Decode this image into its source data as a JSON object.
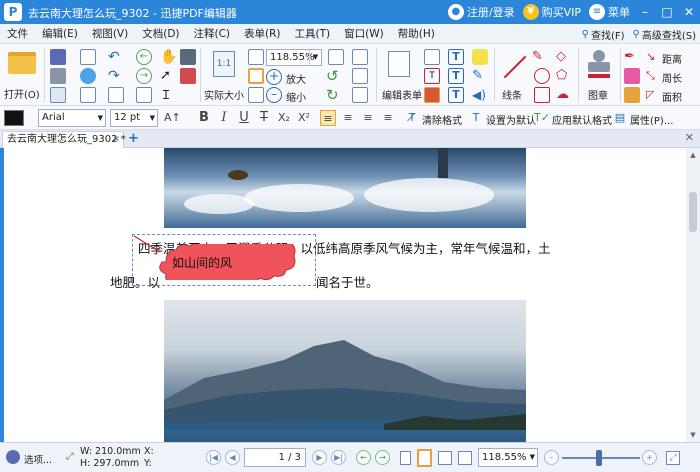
{
  "window": {
    "title": "去云南大理怎么玩_9302 - 迅捷PDF编辑器",
    "app_logo": "P",
    "login": "注册/登录",
    "vip": "购买VIP",
    "menu": "菜单"
  },
  "menubar": {
    "items": [
      "文件",
      "编辑(E)",
      "视图(V)",
      "文档(D)",
      "注释(C)",
      "表单(R)",
      "工具(T)",
      "窗口(W)",
      "帮助(H)"
    ],
    "find": "查找(F)",
    "advanced_find": "高级查找(S)"
  },
  "toolbar": {
    "open": "打开(O)",
    "zoom_value": "118.55%",
    "actual_size": "实际大小",
    "zoom_in": "放大",
    "zoom_out": "缩小",
    "edit_form": "编辑表单",
    "lines": "线条",
    "stamp": "图章",
    "distance": "距离",
    "perimeter": "周长",
    "area": "面积"
  },
  "fmtbar": {
    "font": "Arial",
    "size": "12 pt",
    "clear_format": "清除格式",
    "set_default": "设置为默认",
    "apply_default": "应用默认格式",
    "properties": "属性(P)..."
  },
  "tabs": {
    "active": "去云南大理怎么玩_9302 *"
  },
  "document": {
    "line1": "四季温差不大，干湿季分明，以低纬高原季风气候为主，常年气候温和，土",
    "line2_start": "地肥。以",
    "line2_end": "闻名于世。",
    "callout": "如山间的风"
  },
  "statusbar": {
    "options": "选项...",
    "width": "W: 210.0mm",
    "height": "H: 297.0mm",
    "x": "X:",
    "y": "Y:",
    "page": "1 / 3",
    "zoom": "118.55%"
  }
}
